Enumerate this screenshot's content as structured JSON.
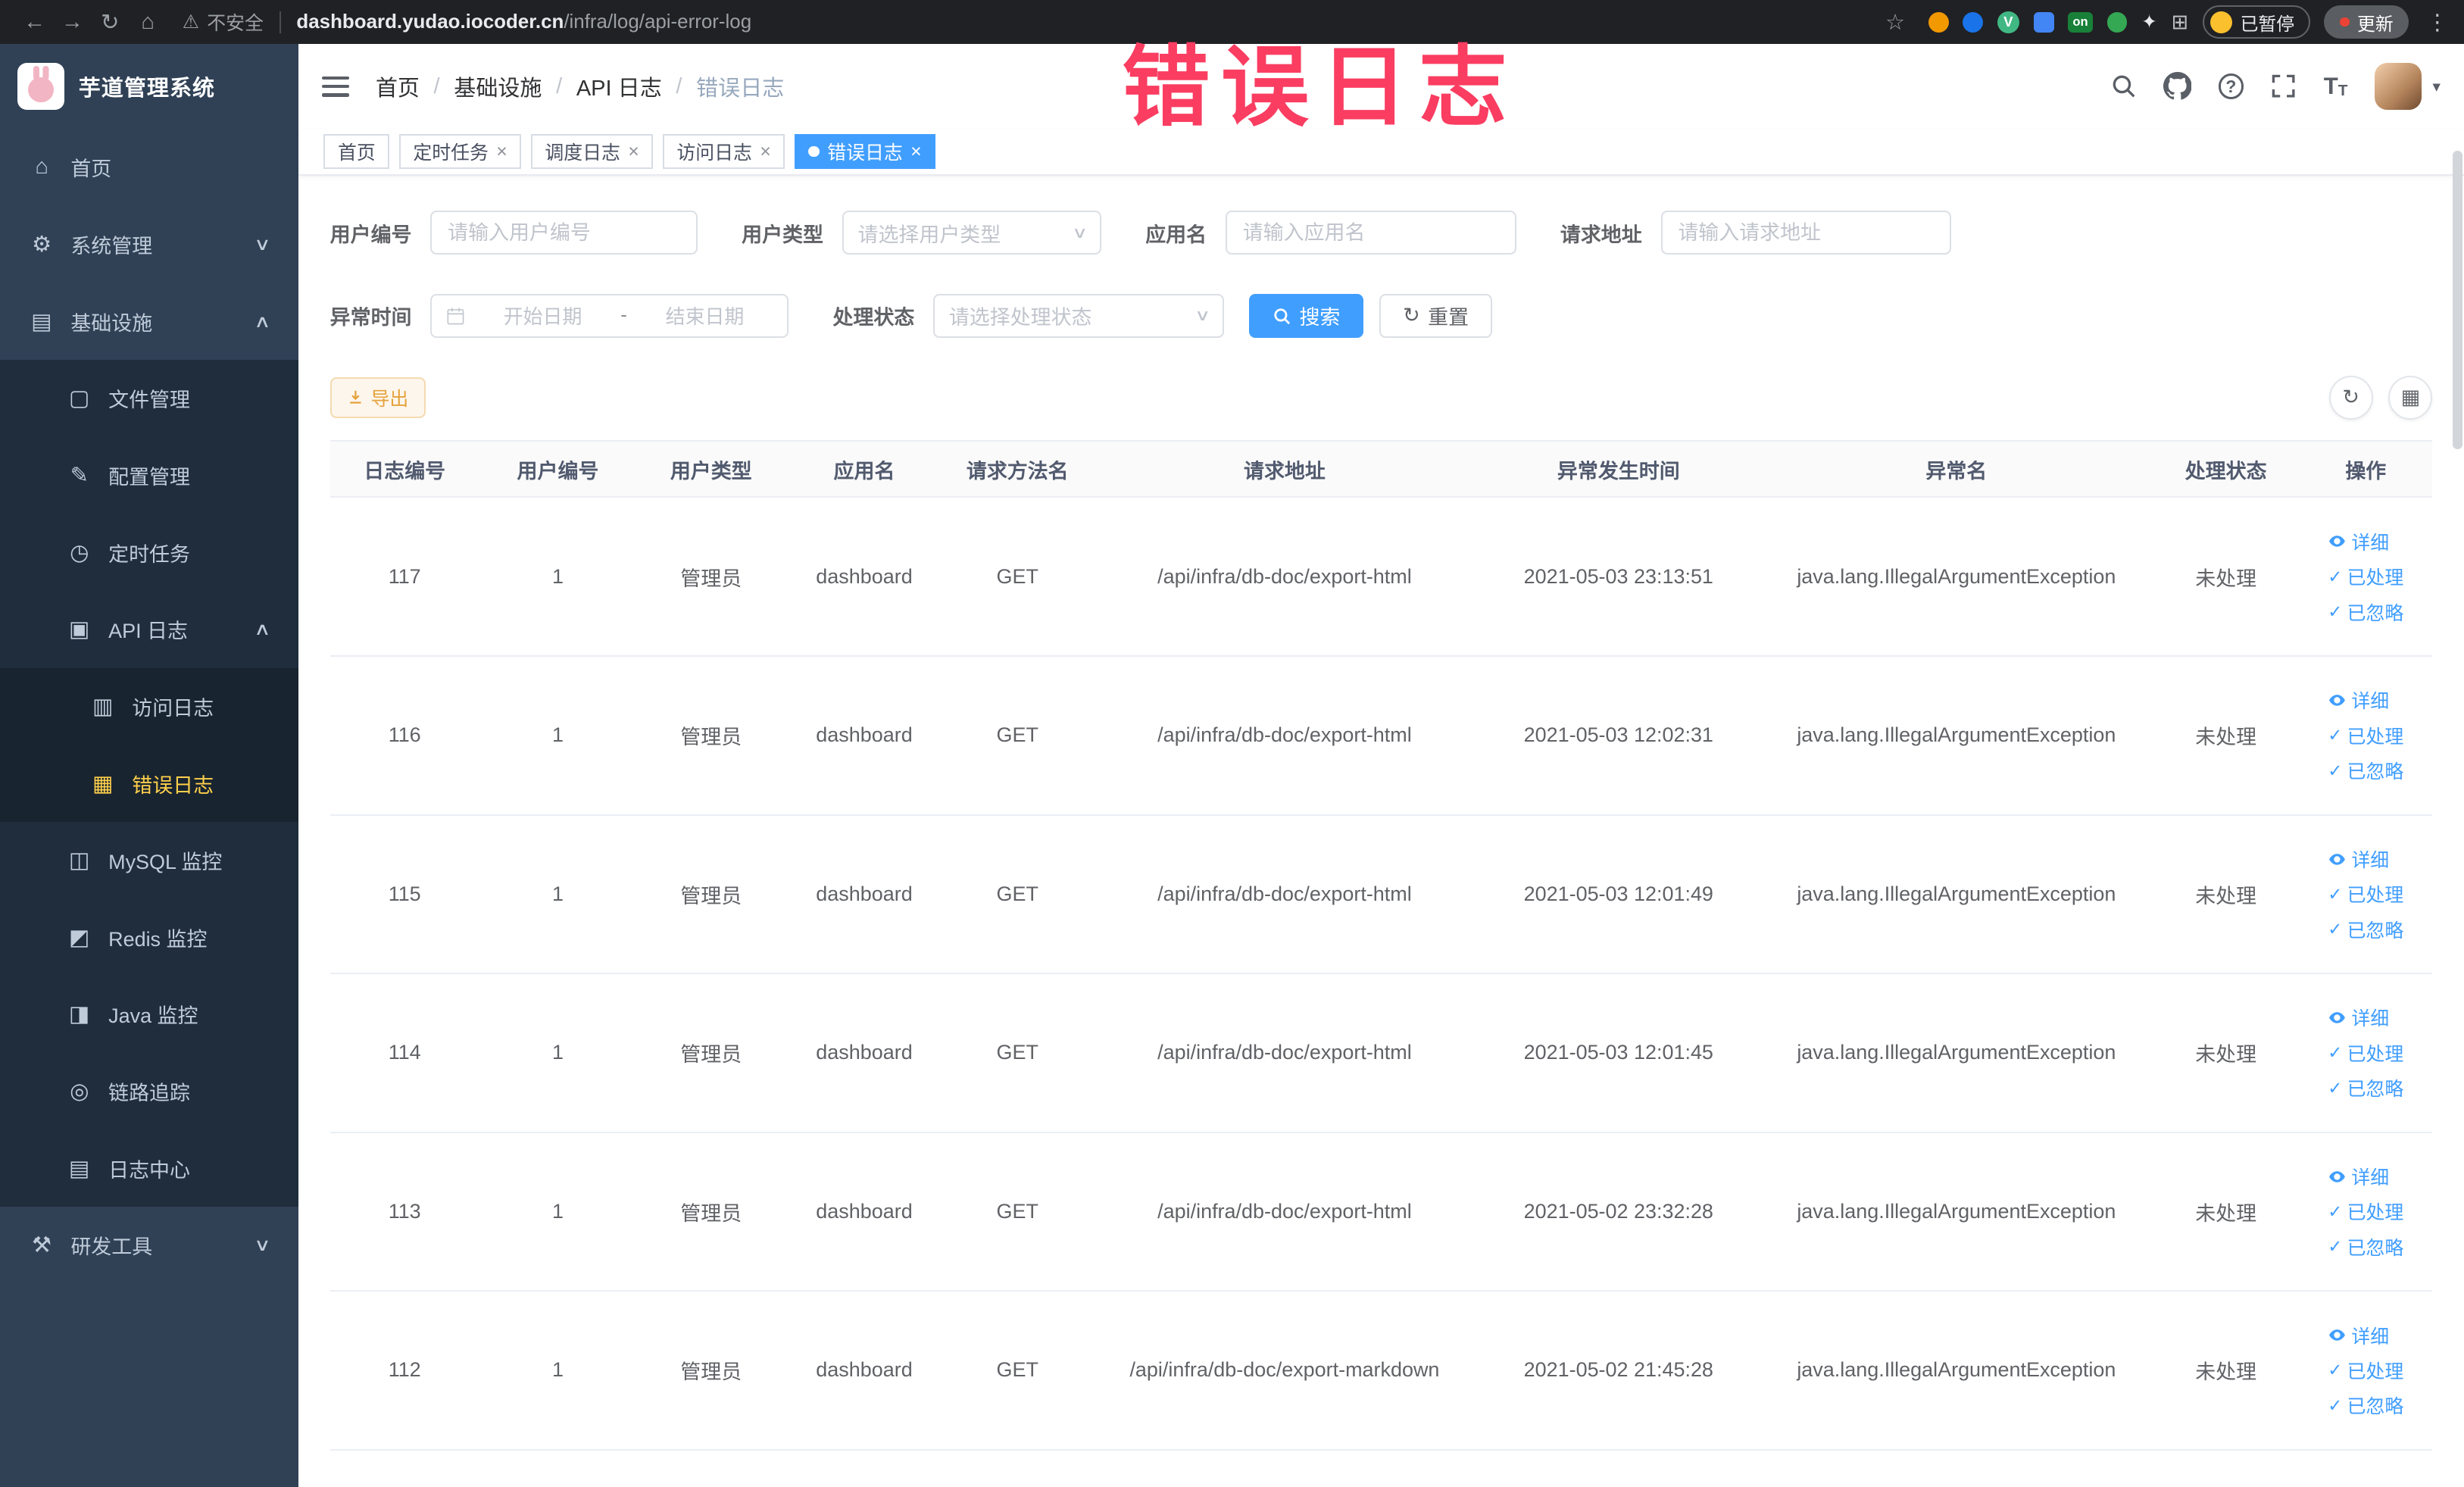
{
  "browser": {
    "security_label": "不安全",
    "url_domain": "dashboard.yudao.iocoder.cn",
    "url_path": "/infra/log/api-error-log",
    "paused_label": "已暂停",
    "update_label": "更新",
    "on_badge": "on",
    "vue_badge": "V"
  },
  "watermark": "错误日志",
  "icons": {
    "back": "←",
    "forward": "→",
    "reload": "↻",
    "home": "⌂",
    "warning": "⚠",
    "star": "☆",
    "puzzle": "⊞",
    "paw": "✦",
    "ellipsis": "⋮",
    "caret_down": "▾",
    "question": "?",
    "text_size_big": "T",
    "text_size_small": "T",
    "select_caret": "∨",
    "check": "✓",
    "refresh": "↻",
    "columns": "▦",
    "reset": "↻"
  },
  "sidebar": {
    "logo_title": "芋道管理系统",
    "items": [
      {
        "label": "首页",
        "icon": "⌂",
        "level": 0
      },
      {
        "label": "系统管理",
        "icon": "⚙",
        "level": 0,
        "arrow": "∨"
      },
      {
        "label": "基础设施",
        "icon": "▤",
        "level": 0,
        "arrow": "∧"
      },
      {
        "label": "文件管理",
        "icon": "▢",
        "level": 1
      },
      {
        "label": "配置管理",
        "icon": "✎",
        "level": 1
      },
      {
        "label": "定时任务",
        "icon": "◷",
        "level": 1
      },
      {
        "label": "API 日志",
        "icon": "▣",
        "level": 1,
        "arrow": "∧"
      },
      {
        "label": "访问日志",
        "icon": "▥",
        "level": 2
      },
      {
        "label": "错误日志",
        "icon": "▦",
        "level": 2,
        "active": true
      },
      {
        "label": "MySQL 监控",
        "icon": "◫",
        "level": 1
      },
      {
        "label": "Redis 监控",
        "icon": "◩",
        "level": 1
      },
      {
        "label": "Java 监控",
        "icon": "◨",
        "level": 1
      },
      {
        "label": "链路追踪",
        "icon": "◎",
        "level": 1
      },
      {
        "label": "日志中心",
        "icon": "▤",
        "level": 1
      },
      {
        "label": "研发工具",
        "icon": "⚒",
        "level": 0,
        "arrow": "∨"
      }
    ]
  },
  "navbar": {
    "breadcrumb": [
      "首页",
      "基础设施",
      "API 日志",
      "错误日志"
    ],
    "separator": "/"
  },
  "tabs": [
    {
      "label": "首页"
    },
    {
      "label": "定时任务",
      "close": "×"
    },
    {
      "label": "调度日志",
      "close": "×"
    },
    {
      "label": "访问日志",
      "close": "×"
    },
    {
      "label": "错误日志",
      "close": "×",
      "active": true
    }
  ],
  "filters": {
    "user_id": {
      "label": "用户编号",
      "placeholder": "请输入用户编号"
    },
    "user_type": {
      "label": "用户类型",
      "placeholder": "请选择用户类型"
    },
    "app_name": {
      "label": "应用名",
      "placeholder": "请输入应用名"
    },
    "request_url": {
      "label": "请求地址",
      "placeholder": "请输入请求地址"
    },
    "exception_time": {
      "label": "异常时间",
      "start_placeholder": "开始日期",
      "separator": "-",
      "end_placeholder": "结束日期"
    },
    "process_status": {
      "label": "处理状态",
      "placeholder": "请选择处理状态"
    },
    "search_button": "搜索",
    "reset_button": "重置"
  },
  "toolbar": {
    "export_button": "导出"
  },
  "table": {
    "headers": [
      "日志编号",
      "用户编号",
      "用户类型",
      "应用名",
      "请求方法名",
      "请求地址",
      "异常发生时间",
      "异常名",
      "处理状态",
      "操作"
    ],
    "action_labels": [
      "详细",
      "已处理",
      "已忽略"
    ],
    "rows": [
      {
        "log_id": "117",
        "user_id": "1",
        "user_type": "管理员",
        "app_name": "dashboard",
        "method": "GET",
        "url": "/api/infra/db-doc/export-html",
        "time": "2021-05-03 23:13:51",
        "exception": "java.lang.IllegalArgumentException",
        "status": "未处理"
      },
      {
        "log_id": "116",
        "user_id": "1",
        "user_type": "管理员",
        "app_name": "dashboard",
        "method": "GET",
        "url": "/api/infra/db-doc/export-html",
        "time": "2021-05-03 12:02:31",
        "exception": "java.lang.IllegalArgumentException",
        "status": "未处理"
      },
      {
        "log_id": "115",
        "user_id": "1",
        "user_type": "管理员",
        "app_name": "dashboard",
        "method": "GET",
        "url": "/api/infra/db-doc/export-html",
        "time": "2021-05-03 12:01:49",
        "exception": "java.lang.IllegalArgumentException",
        "status": "未处理"
      },
      {
        "log_id": "114",
        "user_id": "1",
        "user_type": "管理员",
        "app_name": "dashboard",
        "method": "GET",
        "url": "/api/infra/db-doc/export-html",
        "time": "2021-05-03 12:01:45",
        "exception": "java.lang.IllegalArgumentException",
        "status": "未处理"
      },
      {
        "log_id": "113",
        "user_id": "1",
        "user_type": "管理员",
        "app_name": "dashboard",
        "method": "GET",
        "url": "/api/infra/db-doc/export-html",
        "time": "2021-05-02 23:32:28",
        "exception": "java.lang.IllegalArgumentException",
        "status": "未处理"
      },
      {
        "log_id": "112",
        "user_id": "1",
        "user_type": "管理员",
        "app_name": "dashboard",
        "method": "GET",
        "url": "/api/infra/db-doc/export-markdown",
        "time": "2021-05-02 21:45:28",
        "exception": "java.lang.IllegalArgumentException",
        "status": "未处理"
      }
    ]
  },
  "colors": {
    "accent": "#409eff",
    "chrome_bg": "#202124",
    "sidebar_bg": "#304156",
    "sidebar_sub_bg": "#1f2d3d",
    "sidebar_sub2_bg": "#182430",
    "sidebar_text": "#bfcbd9",
    "sidebar_active": "#ffd04b",
    "watermark": "#fa3d61",
    "warning_text": "#e6a23c",
    "warning_bg": "#fdf6ec",
    "warning_border": "#f5dab1"
  }
}
